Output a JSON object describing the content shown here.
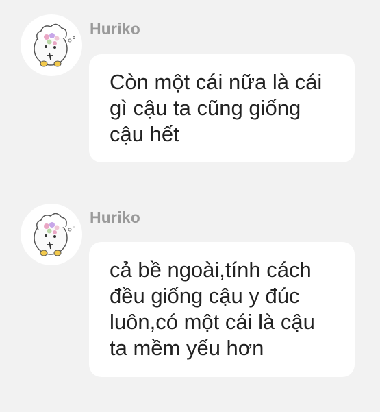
{
  "messages": [
    {
      "sender": "Huriko",
      "lines": [
        "Còn một cái nữa là cái",
        "gì cậu ta cũng giống",
        "cậu hết"
      ]
    },
    {
      "sender": "Huriko",
      "lines": [
        "cả bề ngoài,tính cách",
        "đều giống cậu y đúc",
        "luôn,có một cái là cậu",
        "ta mềm yếu hơn"
      ]
    }
  ],
  "colors": {
    "background": "#f2f2f2",
    "bubble": "#ffffff",
    "sender_name": "#9a9a9a",
    "message_text": "#222222"
  },
  "icons": {
    "avatar": "sheep-with-flowers-avatar-icon"
  }
}
